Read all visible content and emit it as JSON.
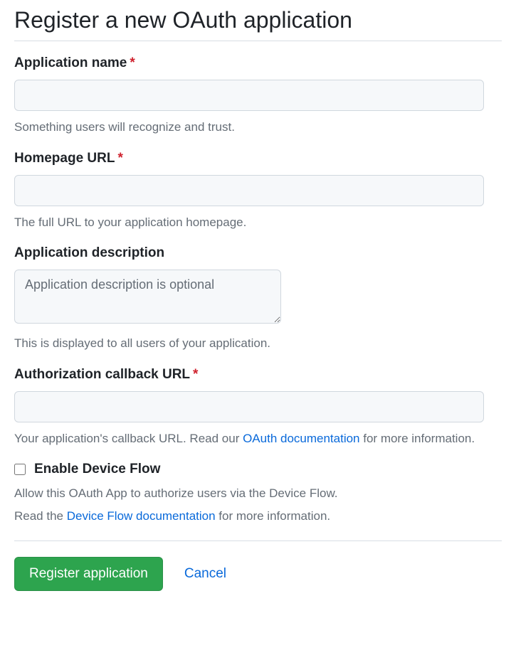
{
  "page": {
    "title": "Register a new OAuth application"
  },
  "fields": {
    "appName": {
      "label": "Application name",
      "required_mark": "*",
      "value": "",
      "help": "Something users will recognize and trust."
    },
    "homepage": {
      "label": "Homepage URL",
      "required_mark": "*",
      "value": "",
      "help": "The full URL to your application homepage."
    },
    "description": {
      "label": "Application description",
      "placeholder": "Application description is optional",
      "value": "",
      "help": "This is displayed to all users of your application."
    },
    "callback": {
      "label": "Authorization callback URL",
      "required_mark": "*",
      "value": "",
      "help_pre": "Your application's callback URL. Read our ",
      "help_link": "OAuth documentation",
      "help_post": " for more information."
    },
    "deviceFlow": {
      "label": "Enable Device Flow",
      "checked": false,
      "help_line1": "Allow this OAuth App to authorize users via the Device Flow.",
      "help_line2_pre": "Read the ",
      "help_line2_link": "Device Flow documentation",
      "help_line2_post": " for more information."
    }
  },
  "actions": {
    "submit": "Register application",
    "cancel": "Cancel"
  }
}
